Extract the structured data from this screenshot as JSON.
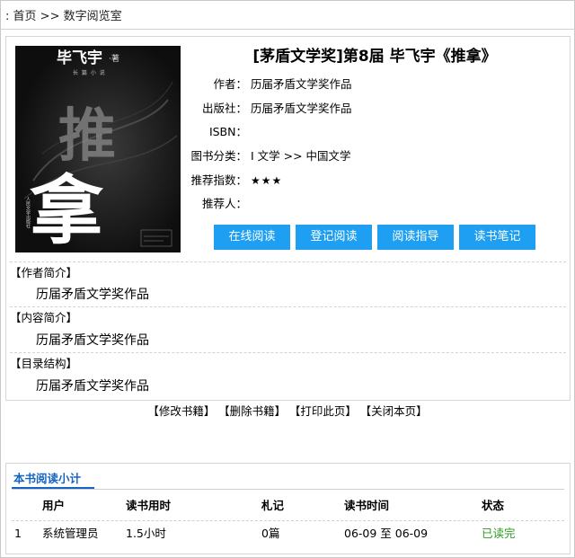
{
  "breadcrumb": {
    "prefix": ": ",
    "home": "首页",
    "sep": ">>",
    "current": "数字阅览室"
  },
  "book": {
    "title": "[茅盾文学奖]第8届 毕飞宇《推拿》",
    "cover": {
      "author_text": "毕飞宇",
      "author_suffix": "·著",
      "subtitle": "长 篇 小 说",
      "big_char_top": "推",
      "big_char_bottom": "拿",
      "publisher": "人民文学出版社"
    },
    "fields": [
      {
        "label": "作者：",
        "value": "历届矛盾文学奖作品"
      },
      {
        "label": "出版社：",
        "value": "历届矛盾文学奖作品"
      },
      {
        "label": "ISBN：",
        "value": ""
      },
      {
        "label": "图书分类：",
        "value": "I 文学 >> 中国文学"
      },
      {
        "label": "推荐指数：",
        "value": "★★★"
      },
      {
        "label": "推荐人：",
        "value": ""
      }
    ],
    "buttons": [
      "在线阅读",
      "登记阅读",
      "阅读指导",
      "读书笔记"
    ],
    "sections": [
      {
        "heading": "【作者简介】",
        "body": "历届矛盾文学奖作品"
      },
      {
        "heading": "【内容简介】",
        "body": "历届矛盾文学奖作品"
      },
      {
        "heading": "【目录结构】",
        "body": "历届矛盾文学奖作品"
      }
    ]
  },
  "actions": [
    "【修改书籍】",
    "【删除书籍】",
    "【打印此页】",
    "【关闭本页】"
  ],
  "stats": {
    "tab": "本书阅读小计",
    "columns": [
      "用户",
      "读书用时",
      "札记",
      "读书时间",
      "状态"
    ],
    "rows": [
      {
        "index": "1",
        "user": "系统管理员",
        "time_spent": "1.5小时",
        "notes": "0篇",
        "period": "06-09 至 06-09",
        "status": "已读完"
      }
    ],
    "status_color": "#2e9b1f"
  },
  "colors": {
    "button": "#1e9ff2",
    "tab_accent": "#1565c0"
  }
}
